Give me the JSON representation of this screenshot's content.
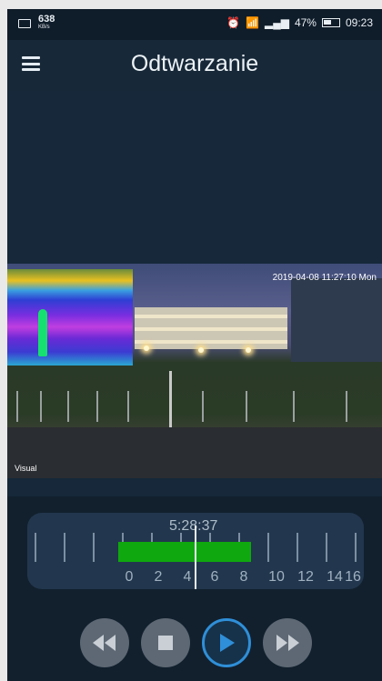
{
  "status_bar": {
    "speed_value": "638",
    "speed_unit": "KB/s",
    "battery": "47%",
    "time": "09:23"
  },
  "app_bar": {
    "title": "Odtwarzanie"
  },
  "video": {
    "timestamp": "2019-04-08 11:27:10 Mon",
    "camera_name": "Visual"
  },
  "timeline": {
    "cursor_time": "5:28:37",
    "labels": [
      "0",
      "2",
      "4",
      "6",
      "8",
      "10",
      "12",
      "14",
      "16"
    ]
  },
  "controls": {
    "icons": [
      "rewind-icon",
      "stop-icon",
      "play-icon",
      "fast-forward-icon"
    ],
    "accent": "#2f8fd8"
  }
}
